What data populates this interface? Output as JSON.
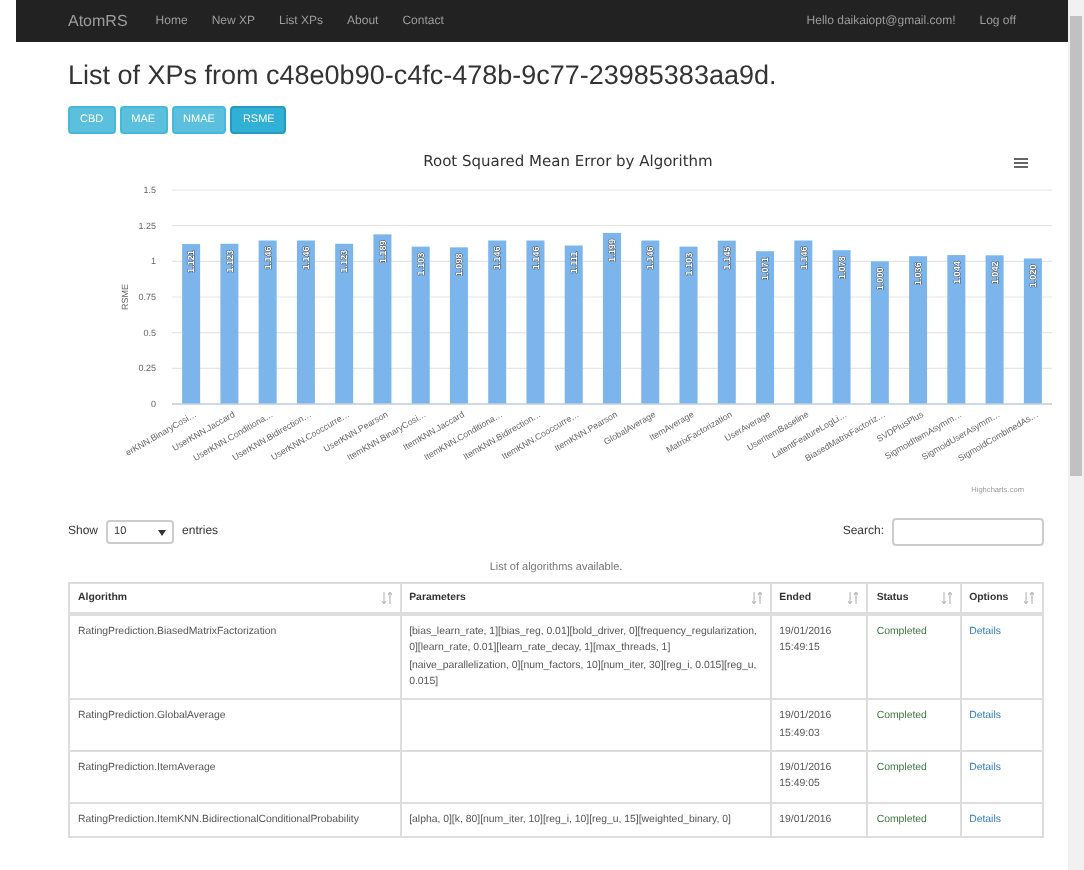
{
  "navbar": {
    "brand": "AtomRS",
    "links": [
      "Home",
      "New XP",
      "List XPs",
      "About",
      "Contact"
    ],
    "user": "Hello daikaiopt@gmail.com!",
    "logoff": "Log off"
  },
  "title": "List of XPs from c48e0b90-c4fc-478b-9c77-23985383aa9d.",
  "metric_buttons": [
    {
      "label": "CBD",
      "selected": false
    },
    {
      "label": "MAE",
      "selected": false
    },
    {
      "label": "NMAE",
      "selected": false
    },
    {
      "label": "RSME",
      "selected": true
    }
  ],
  "chart": {
    "credit": "Highcharts.com",
    "chart_data": {
      "type": "bar",
      "title": "Root Squared Mean Error by Algorithm",
      "ylabel": "RSME",
      "value_labels": [
        "1.121",
        "1.123",
        "1.146",
        "1.146",
        "1.123",
        "1.189",
        "1.103",
        "1.098",
        "1.146",
        "1.146",
        "1.111",
        "1.199",
        "1.146",
        "1.103",
        "1.145",
        "1.071",
        "1.146",
        "1.078",
        "1.000",
        "1.036",
        "1.044",
        "1.042",
        "1.020"
      ],
      "grid": true,
      "ylim": [
        0,
        1.5
      ],
      "yticks": [
        0,
        0.25,
        0.5,
        0.75,
        1,
        1.25,
        1.5
      ],
      "categories": [
        "erKNN.BinaryCosi…",
        "UserKNN.Jaccard",
        "UserKNN.Conditiona…",
        "UserKNN.Bidirection…",
        "UserKNN.Cooccurre…",
        "UserKNN.Pearson",
        "ItemKNN.BinaryCosi…",
        "ItemKNN.Jaccard",
        "ItemKNN.Conditiona…",
        "ItemKNN.Bidirection…",
        "ItemKNN.Cooccurre…",
        "ItemKNN.Pearson",
        "GlobalAverage",
        "ItemAverage",
        "MatrixFactorization",
        "UserAverage",
        "UserItemBaseline",
        "LatentFeatureLogLi…",
        "BiasedMatrixFactoriz…",
        "SVDPlusPlus",
        "SigmoidItemAsymm…",
        "SigmoidUserAsymm…",
        "SigmoidCombinedAs…"
      ],
      "series": [
        {
          "color": "#7cb5ec",
          "values": [
            1.121,
            1.123,
            1.146,
            1.146,
            1.123,
            1.189,
            1.103,
            1.098,
            1.146,
            1.146,
            1.111,
            1.199,
            1.146,
            1.103,
            1.145,
            1.071,
            1.146,
            1.078,
            1.0,
            1.036,
            1.044,
            1.042,
            1.02
          ]
        }
      ]
    }
  },
  "table_controls": {
    "show_label": "Show",
    "page_size": "10",
    "entries_label": "entries",
    "search_label": "Search:"
  },
  "caption": "List of algorithms available.",
  "table": {
    "columns": [
      "Algorithm",
      "Parameters",
      "Ended",
      "Status",
      "Options"
    ],
    "rows": [
      {
        "algorithm": "RatingPrediction.BiasedMatrixFactorization",
        "parameters": "[bias_learn_rate, 1][bias_reg, 0.01][bold_driver, 0][frequency_regularization, 0][learn_rate, 0.01][learn_rate_decay, 1][max_threads, 1][naive_parallelization, 0][num_factors, 10][num_iter, 30][reg_i, 0.015][reg_u, 0.015]",
        "ended": "19/01/2016 15:49:15",
        "status": "Completed",
        "options": "Details"
      },
      {
        "algorithm": "RatingPrediction.GlobalAverage",
        "parameters": "",
        "ended": "19/01/2016 15:49:03",
        "status": "Completed",
        "options": "Details"
      },
      {
        "algorithm": "RatingPrediction.ItemAverage",
        "parameters": "",
        "ended": "19/01/2016 15:49:05",
        "status": "Completed",
        "options": "Details"
      },
      {
        "algorithm": "RatingPrediction.ItemKNN.BidirectionalConditionalProbability",
        "parameters": "[alpha, 0][k, 80][num_iter, 10][reg_i, 10][reg_u, 15][weighted_binary, 0]",
        "ended": "19/01/2016",
        "status": "Completed",
        "options": "Details"
      }
    ]
  }
}
